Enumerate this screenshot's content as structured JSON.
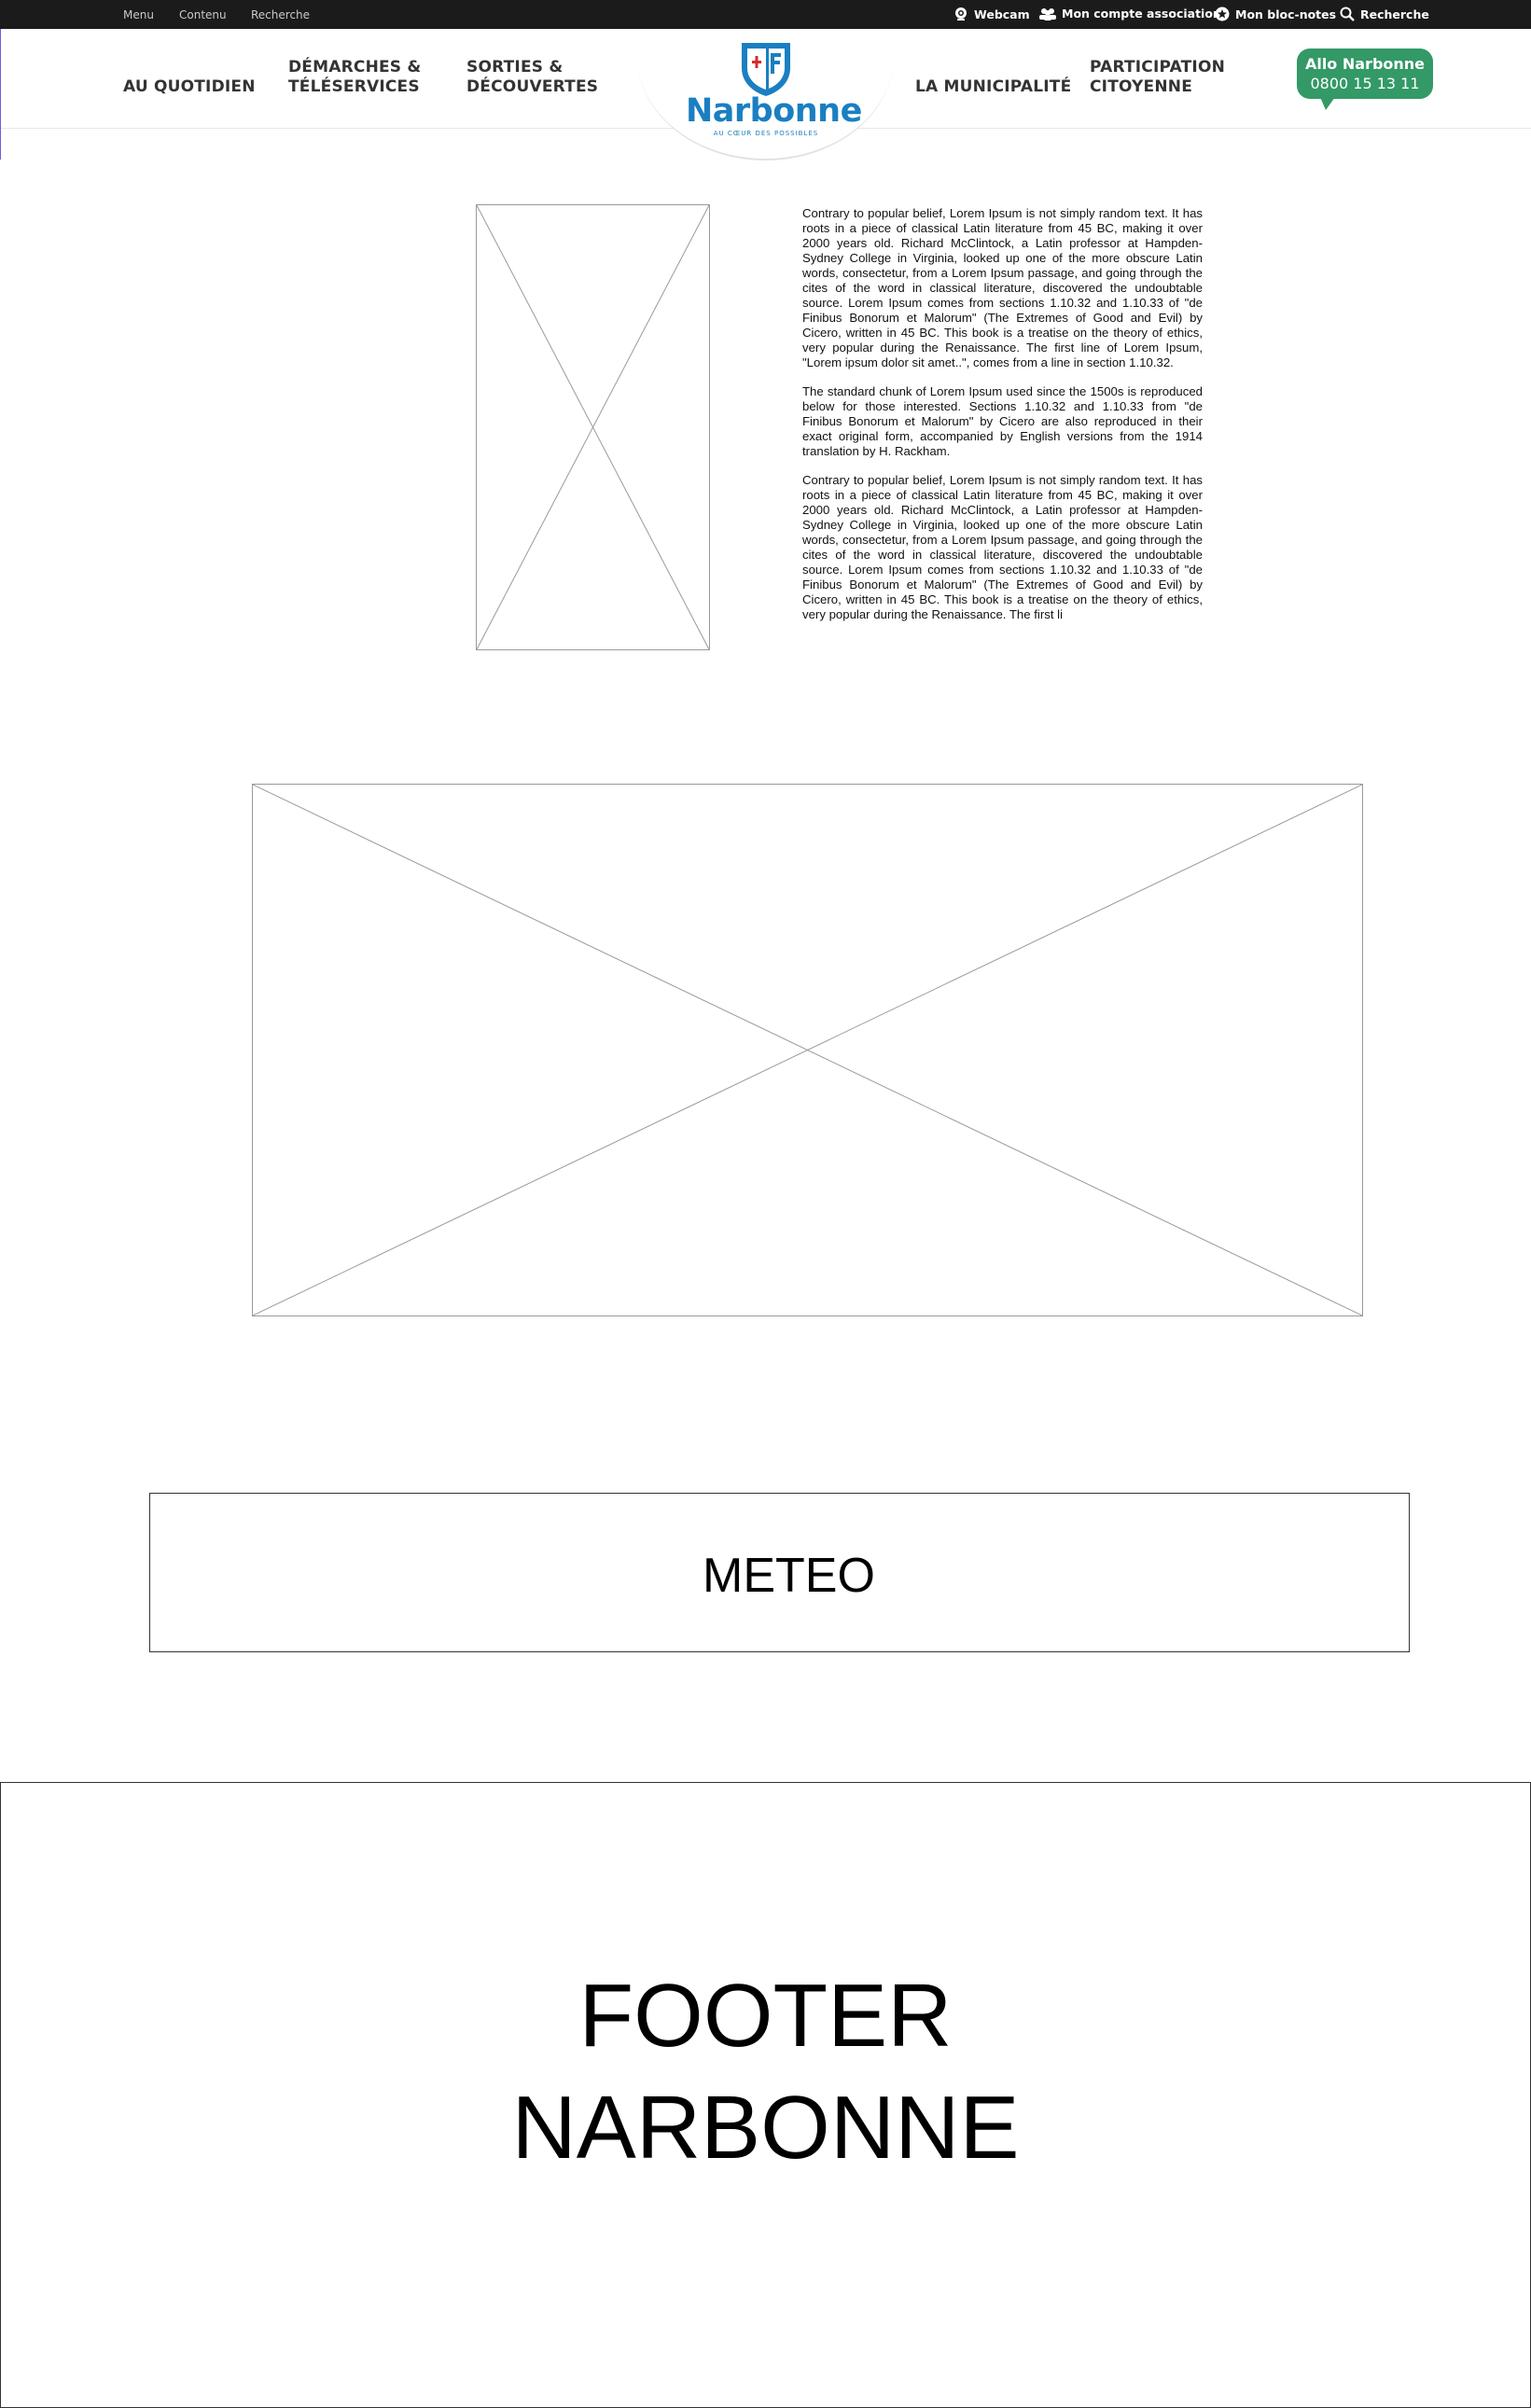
{
  "topbar": {
    "skip_links": [
      "Menu",
      "Contenu",
      "Recherche"
    ],
    "utility": {
      "webcam": "Webcam",
      "association": "Mon compte association",
      "notes": "Mon bloc-notes",
      "search": "Recherche"
    }
  },
  "nav": {
    "left": [
      {
        "line1": "AU QUOTIDIEN",
        "line2": ""
      },
      {
        "line1": "DÉMARCHES &",
        "line2": "TÉLÉSERVICES"
      },
      {
        "line1": "SORTIES &",
        "line2": "DÉCOUVERTES"
      }
    ],
    "right": [
      {
        "line1": "LA MUNICIPALITÉ",
        "line2": ""
      },
      {
        "line1": "PARTICIPATION",
        "line2": "CITOYENNE"
      }
    ]
  },
  "logo": {
    "title": "Narbonne",
    "tagline": "AU CŒUR DES POSSIBLES"
  },
  "allo": {
    "title": "Allo Narbonne",
    "phone": "0800 15 13 11"
  },
  "content": {
    "paragraphs": [
      "Contrary to popular belief, Lorem Ipsum is not simply random text. It has roots in a piece of classical Latin literature from 45 BC, making it over 2000 years old. Richard McClintock, a Latin professor at Hampden-Sydney College in Virginia, looked up one of the more obscure Latin words, consectetur, from a Lorem Ipsum passage, and going through the cites of the word in classical literature, discovered the undoubtable source. Lorem Ipsum comes from sections 1.10.32 and 1.10.33 of \"de Finibus Bonorum et Malorum\" (The Extremes of Good and Evil) by Cicero, written in 45 BC. This book is a treatise on the theory of ethics, very popular during the Renaissance. The first line of Lorem Ipsum, \"Lorem ipsum dolor sit amet..\", comes from a line in section 1.10.32.",
      "The standard chunk of Lorem Ipsum used since the 1500s is reproduced below for those interested. Sections 1.10.32 and 1.10.33 from \"de Finibus Bonorum et Malorum\" by Cicero are also reproduced in their exact original form, accompanied by English versions from the 1914 translation by H. Rackham.",
      "Contrary to popular belief, Lorem Ipsum is not simply random text. It has roots in a piece of classical Latin literature from 45 BC, making it over 2000 years old. Richard McClintock, a Latin professor at Hampden-Sydney College in Virginia, looked up one of the more obscure Latin words, consectetur, from a Lorem Ipsum passage, and going through the cites of the word in classical literature, discovered the undoubtable source. Lorem Ipsum comes from sections 1.10.32 and 1.10.33 of \"de Finibus Bonorum et Malorum\" (The Extremes of Good and Evil) by Cicero, written in 45 BC. This book is a treatise on the theory of ethics, very popular during the Renaissance. The first li"
    ]
  },
  "meteo": {
    "label": "METEO"
  },
  "footer": {
    "line1": "FOOTER",
    "line2": "NARBONNE"
  },
  "colors": {
    "topbar": "#1b1b1b",
    "brand_blue": "#1a7fc1",
    "allo_green": "#339966",
    "shield_red": "#d62b2b"
  }
}
